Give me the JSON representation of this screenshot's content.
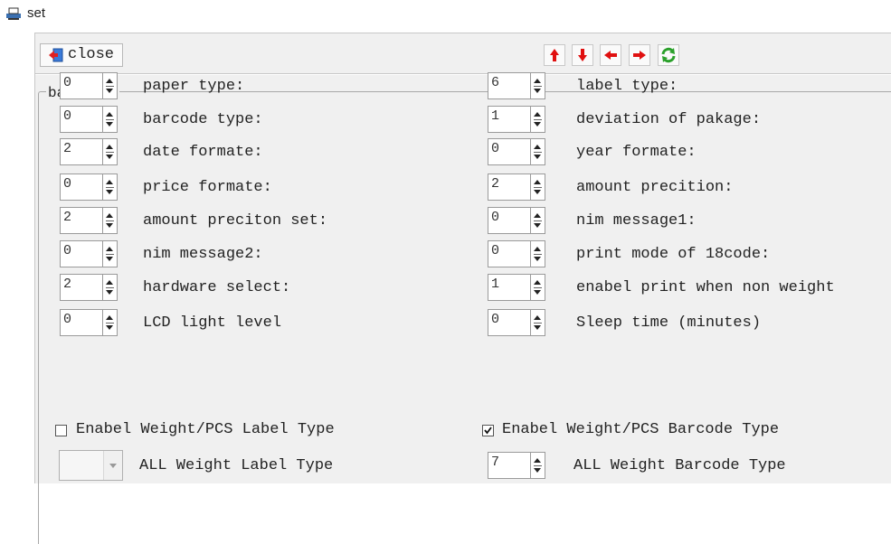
{
  "window": {
    "title": "set",
    "icon": "printer-icon"
  },
  "toolbar": {
    "close_label": "close",
    "close_icon": "exit-door-icon",
    "nav_buttons": [
      {
        "icon": "arrow-up-icon"
      },
      {
        "icon": "arrow-down-icon"
      },
      {
        "icon": "arrow-left-icon"
      },
      {
        "icon": "arrow-right-icon"
      },
      {
        "icon": "refresh-icon"
      }
    ],
    "arrow_color": "#e01010",
    "refresh_color": "#2aa02a"
  },
  "base_set": {
    "title": "base set",
    "left": [
      {
        "value": "0",
        "label": "paper type:"
      },
      {
        "value": "0",
        "label": "barcode type:"
      },
      {
        "value": "2",
        "label": "date formate:"
      },
      {
        "value": "0",
        "label": "price formate:"
      },
      {
        "value": "2",
        "label": "amount preciton set:"
      },
      {
        "value": "0",
        "label": "nim message2:"
      },
      {
        "value": "2",
        "label": "hardware select:"
      },
      {
        "value": "0",
        "label": "LCD light level"
      }
    ],
    "right": [
      {
        "value": "6",
        "label": "label type:"
      },
      {
        "value": "1",
        "label": "deviation of pakage:"
      },
      {
        "value": "0",
        "label": "year formate:"
      },
      {
        "value": "2",
        "label": "amount precition:"
      },
      {
        "value": "0",
        "label": "nim message1:"
      },
      {
        "value": "0",
        "label": "print mode of 18code:"
      },
      {
        "value": "1",
        "label": "enabel print when non weight"
      },
      {
        "value": "0",
        "label": "Sleep time (minutes)"
      }
    ]
  },
  "options": {
    "weight_label_type": {
      "label": "Enabel Weight/PCS Label Type",
      "checked": false
    },
    "weight_barcode_type": {
      "label": "Enabel Weight/PCS Barcode Type",
      "checked": true
    },
    "all_weight_label": {
      "value": "",
      "label": "ALL Weight Label Type"
    },
    "all_weight_barcode": {
      "value": "7",
      "label": "ALL Weight Barcode Type"
    }
  }
}
